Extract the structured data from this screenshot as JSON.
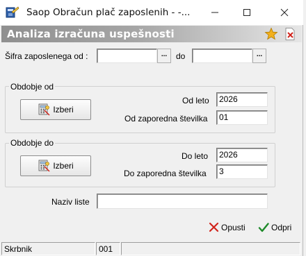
{
  "window": {
    "title": "Saop Obračun plač zaposlenih -  -..."
  },
  "header": {
    "title": "Analiza izračuna uspešnosti"
  },
  "employee_filter": {
    "from_label": "Šifra zaposlenega od :",
    "from_value": "",
    "to_label": "do",
    "to_value": "",
    "browse_label": "..."
  },
  "period_from": {
    "legend": "Obdobje od",
    "select_label": "Izberi",
    "year_label": "Od leto",
    "year_value": "2026",
    "seq_label": "Od zaporedna številka",
    "seq_value": "01"
  },
  "period_to": {
    "legend": "Obdobje do",
    "select_label": "Izberi",
    "year_label": "Do leto",
    "year_value": "2026",
    "seq_label": "Do zaporedna številka",
    "seq_value": "3"
  },
  "list_name": {
    "label": "Naziv liste",
    "value": ""
  },
  "actions": {
    "cancel_label": "Opusti",
    "open_label": "Odpri"
  },
  "statusbar": {
    "user": "Skrbnik",
    "code": "001",
    "extra": ""
  },
  "icons": {
    "app": "app-icon",
    "favorite": "star-icon",
    "close_document": "close-document-icon",
    "select": "calculator-icon",
    "cancel": "x-icon",
    "open": "checkmark-icon"
  },
  "colors": {
    "header_gradient_start": "#8f8f8f",
    "header_gradient_end": "#e6e6e6",
    "cancel_red": "#d0241c",
    "open_green": "#1e8a2a",
    "star_gold": "#f2b01e"
  }
}
